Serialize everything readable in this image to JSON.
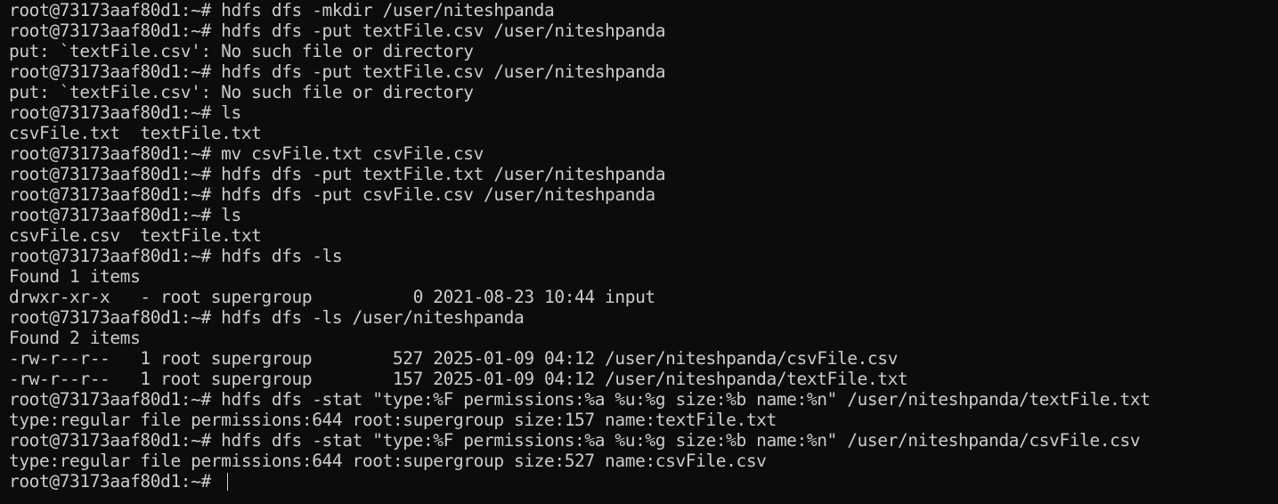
{
  "terminal": {
    "colors": {
      "background": "#0c0c0c",
      "foreground": "#cccccc"
    },
    "lines": [
      "root@73173aaf80d1:~# hdfs dfs -mkdir /user/niteshpanda",
      "root@73173aaf80d1:~# hdfs dfs -put textFile.csv /user/niteshpanda",
      "put: `textFile.csv': No such file or directory",
      "root@73173aaf80d1:~# hdfs dfs -put textFile.csv /user/niteshpanda",
      "put: `textFile.csv': No such file or directory",
      "root@73173aaf80d1:~# ls",
      "csvFile.txt  textFile.txt",
      "root@73173aaf80d1:~# mv csvFile.txt csvFile.csv",
      "root@73173aaf80d1:~# hdfs dfs -put textFile.txt /user/niteshpanda",
      "root@73173aaf80d1:~# hdfs dfs -put csvFile.csv /user/niteshpanda",
      "root@73173aaf80d1:~# ls",
      "csvFile.csv  textFile.txt",
      "root@73173aaf80d1:~# hdfs dfs -ls",
      "Found 1 items",
      "drwxr-xr-x   - root supergroup          0 2021-08-23 10:44 input",
      "root@73173aaf80d1:~# hdfs dfs -ls /user/niteshpanda",
      "Found 2 items",
      "-rw-r--r--   1 root supergroup        527 2025-01-09 04:12 /user/niteshpanda/csvFile.csv",
      "-rw-r--r--   1 root supergroup        157 2025-01-09 04:12 /user/niteshpanda/textFile.txt",
      "root@73173aaf80d1:~# hdfs dfs -stat \"type:%F permissions:%a %u:%g size:%b name:%n\" /user/niteshpanda/textFile.txt",
      "type:regular file permissions:644 root:supergroup size:157 name:textFile.txt",
      "root@73173aaf80d1:~# hdfs dfs -stat \"type:%F permissions:%a %u:%g size:%b name:%n\" /user/niteshpanda/csvFile.csv",
      "type:regular file permissions:644 root:supergroup size:527 name:csvFile.csv"
    ],
    "prompt": "root@73173aaf80d1:~# ",
    "current_input": ""
  }
}
